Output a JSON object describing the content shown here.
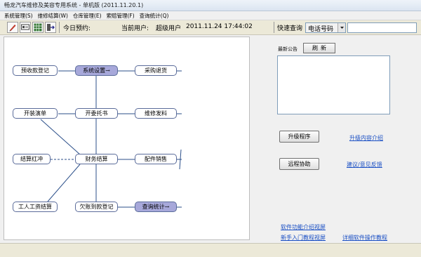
{
  "window": {
    "title": "畅龙汽车维修及美容专用系统 - 单机版 (2011.11.20.1)"
  },
  "menu": [
    {
      "label": "系统管理(S)"
    },
    {
      "label": "维修结算(W)"
    },
    {
      "label": "仓库管理(E)"
    },
    {
      "label": "索赔管理(F)"
    },
    {
      "label": "查询统计(Q)"
    }
  ],
  "toolbar": {
    "today_label": "今日预约:",
    "current_user_label": "当前用户:",
    "current_user_value": "超级用户",
    "datetime": "2011.11.24 17:44:02",
    "quick_query_label": "快速查询",
    "query_field_value": "电话号码",
    "query_input_value": ""
  },
  "icons": {
    "tool1": "pencil-icon",
    "tool2": "key-icon",
    "tool3": "grid-icon",
    "tool4": "exit-icon"
  },
  "diagram": {
    "nodes": {
      "prepay": "预收款登记",
      "settings": "系统设置→",
      "purchase_return": "采购退货",
      "open_order": "开装演单",
      "open_delegate": "开委托书",
      "repair_issue": "维修发料",
      "settle_red": "结算红冲",
      "finance_settle": "财务结算",
      "parts_sale": "配件销售",
      "wage_settle": "工人工资结算",
      "debt_register": "欠账到款登记",
      "query_stats": "查询统计→"
    }
  },
  "right_panel": {
    "notice_label": "最新公告",
    "refresh_label": "刷新",
    "notice_content": "",
    "upgrade_button": "升级程序",
    "upgrade_link": "升级内容介绍",
    "remote_button": "远程协助",
    "feedback_link": "建议/意见反馈",
    "video_intro_link": "软件功能介绍视屏",
    "video_beginner_link": "新手入门教程视屏",
    "video_detail_link": "详细软件操作教程"
  },
  "colors": {
    "node_border": "#5b6c9a",
    "node_highlight": "#a7a8da",
    "line": "#2b4f8a",
    "link": "#1a4fc4"
  }
}
